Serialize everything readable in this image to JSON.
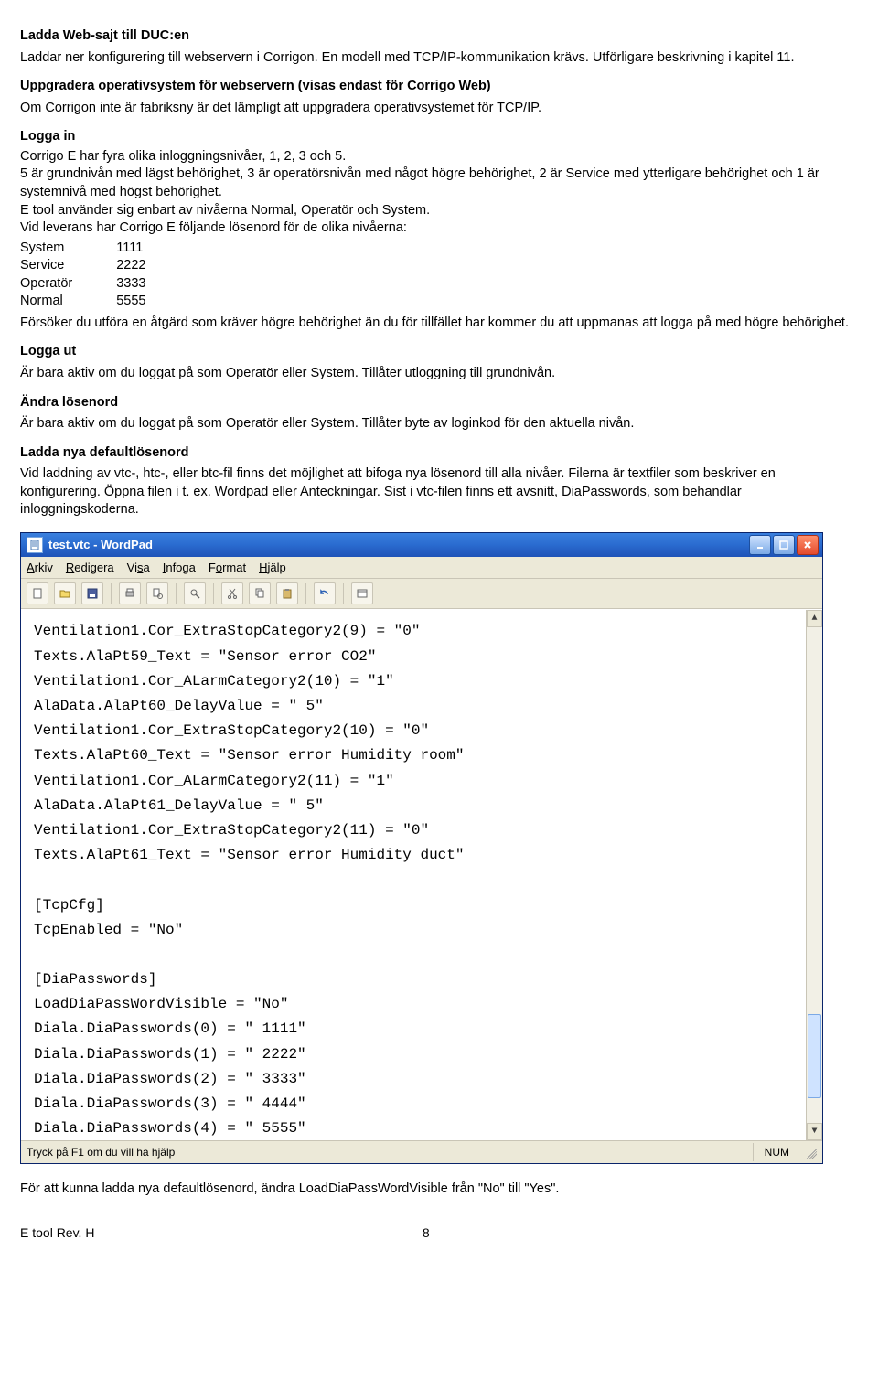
{
  "sections": {
    "ladda_web": {
      "title": "Ladda Web-sajt till DUC:en",
      "text": "Laddar ner konfigurering till webservern i Corrigon. En modell med TCP/IP-kommunikation krävs. Utförligare beskrivning i kapitel 11."
    },
    "uppgradera": {
      "title": "Uppgradera operativsystem för webservern (visas endast för Corrigo Web)",
      "text": "Om Corrigon inte är fabriksny är det lämpligt att uppgradera operativsystemet för TCP/IP."
    },
    "logga_in": {
      "title": "Logga in",
      "p1": "Corrigo E har fyra olika inloggningsnivåer, 1, 2, 3 och 5.",
      "p2": "5 är grundnivån med lägst behörighet, 3 är operatörsnivån med något högre behörighet, 2 är Service med ytterligare behörighet och 1 är systemnivå med högst behörighet.",
      "p3": "E tool använder sig enbart av nivåerna Normal, Operatör och System.",
      "p4": "Vid leverans har Corrigo E följande lösenord för de olika nivåerna:",
      "pw": [
        {
          "name": "System",
          "value": "1111"
        },
        {
          "name": "Service",
          "value": "2222"
        },
        {
          "name": "Operatör",
          "value": "3333"
        },
        {
          "name": "Normal",
          "value": "5555"
        }
      ],
      "p5": "Försöker du utföra en åtgärd som kräver högre behörighet än du för tillfället har  kommer du att uppmanas att logga på med högre behörighet."
    },
    "logga_ut": {
      "title": "Logga ut",
      "text": "Är bara aktiv om du loggat på som Operatör eller System. Tillåter utloggning till grundnivån."
    },
    "andra": {
      "title": "Ändra lösenord",
      "text": "Är bara aktiv om du loggat på som Operatör eller System. Tillåter byte av loginkod för den aktuella nivån."
    },
    "ladda_nya": {
      "title": "Ladda nya defaultlösenord",
      "text": "Vid laddning av vtc-, htc-, eller btc-fil finns det möjlighet att bifoga nya lösenord till alla nivåer. Filerna är textfiler som beskriver en konfigurering. Öppna filen i t. ex. Wordpad eller Anteckningar. Sist i vtc-filen finns ett avsnitt, DiaPasswords, som behandlar inloggningskoderna."
    },
    "after_img": "För att kunna ladda nya defaultlösenord, ändra LoadDiaPassWordVisible från \"No\" till \"Yes\"."
  },
  "wordpad": {
    "title": "test.vtc - WordPad",
    "menu": [
      "Arkiv",
      "Redigera",
      "Visa",
      "Infoga",
      "Format",
      "Hjälp"
    ],
    "status_left": "Tryck på F1 om du vill ha hjälp",
    "status_right": "NUM",
    "content": "Ventilation1.Cor_ExtraStopCategory2(9) = \"0\"\nTexts.AlaPt59_Text = \"Sensor error CO2\"\nVentilation1.Cor_ALarmCategory2(10) = \"1\"\nAlaData.AlaPt60_DelayValue = \" 5\"\nVentilation1.Cor_ExtraStopCategory2(10) = \"0\"\nTexts.AlaPt60_Text = \"Sensor error Humidity room\"\nVentilation1.Cor_ALarmCategory2(11) = \"1\"\nAlaData.AlaPt61_DelayValue = \" 5\"\nVentilation1.Cor_ExtraStopCategory2(11) = \"0\"\nTexts.AlaPt61_Text = \"Sensor error Humidity duct\"\n\n[TcpCfg]\nTcpEnabled = \"No\"\n\n[DiaPasswords]\nLoadDiaPassWordVisible = \"No\"\nDiala.DiaPasswords(0) = \" 1111\"\nDiala.DiaPasswords(1) = \" 2222\"\nDiala.DiaPasswords(2) = \" 3333\"\nDiala.DiaPasswords(3) = \" 4444\"\nDiala.DiaPasswords(4) = \" 5555\""
  },
  "footer": {
    "left": "E tool  Rev. H",
    "page": "8"
  }
}
